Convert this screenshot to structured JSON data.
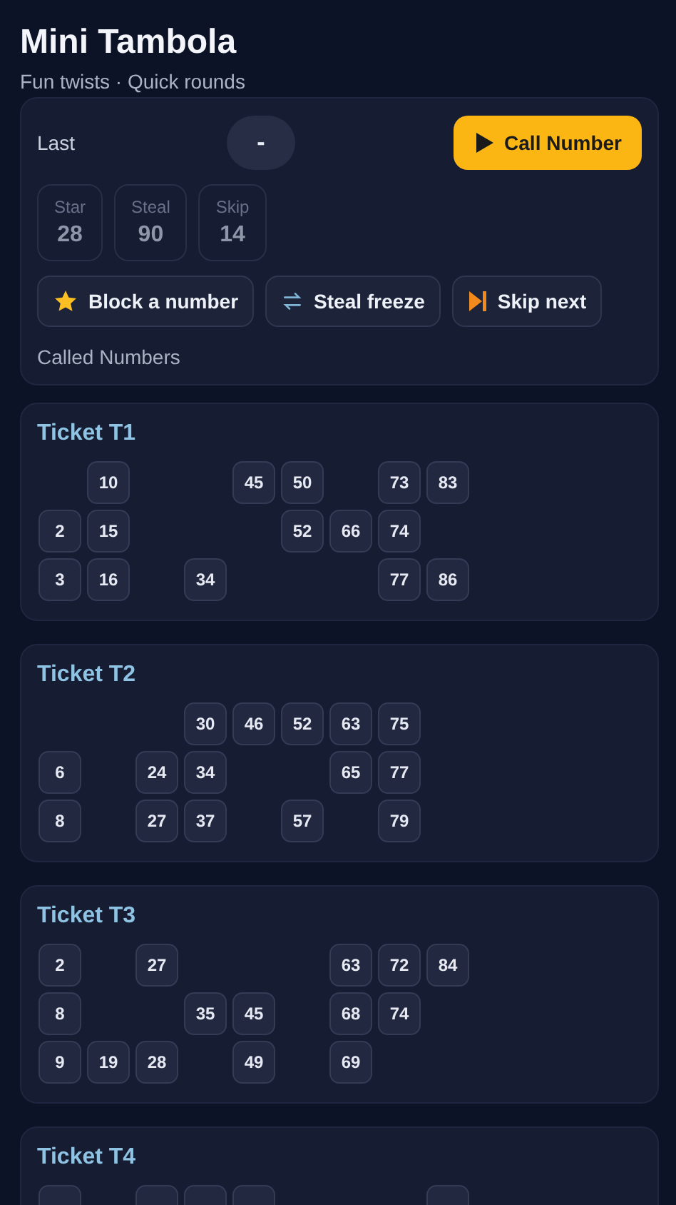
{
  "header": {
    "title": "Mini Tambola",
    "subtitle": "Fun twists · Quick rounds"
  },
  "controls": {
    "last_label": "Last",
    "last_value": "-",
    "call_button": "Call Number",
    "stats": [
      {
        "label": "Star",
        "value": "28"
      },
      {
        "label": "Steal",
        "value": "90"
      },
      {
        "label": "Skip",
        "value": "14"
      }
    ],
    "actions": [
      {
        "kind": "star",
        "label": "Block a number"
      },
      {
        "kind": "swap",
        "label": "Steal freeze"
      },
      {
        "kind": "skip",
        "label": "Skip next"
      }
    ],
    "called_label": "Called Numbers"
  },
  "tickets": [
    {
      "title": "Ticket T1",
      "rows": [
        [
          null,
          "10",
          null,
          null,
          "45",
          "50",
          null,
          "73",
          "83"
        ],
        [
          "2",
          "15",
          null,
          null,
          null,
          "52",
          "66",
          "74",
          null
        ],
        [
          "3",
          "16",
          null,
          "34",
          null,
          null,
          null,
          "77",
          "86"
        ]
      ]
    },
    {
      "title": "Ticket T2",
      "rows": [
        [
          null,
          null,
          null,
          "30",
          "46",
          "52",
          "63",
          "75",
          null
        ],
        [
          "6",
          null,
          "24",
          "34",
          null,
          null,
          "65",
          "77",
          null
        ],
        [
          "8",
          null,
          "27",
          "37",
          null,
          "57",
          null,
          "79",
          null
        ]
      ]
    },
    {
      "title": "Ticket T3",
      "rows": [
        [
          "2",
          null,
          "27",
          null,
          null,
          null,
          "63",
          "72",
          "84"
        ],
        [
          "8",
          null,
          null,
          "35",
          "45",
          null,
          "68",
          "74",
          null
        ],
        [
          "9",
          "19",
          "28",
          null,
          "49",
          null,
          "69",
          null,
          null
        ]
      ]
    },
    {
      "title": "Ticket T4",
      "cut_row": [
        true,
        false,
        true,
        true,
        true,
        false,
        false,
        false,
        true
      ]
    }
  ]
}
